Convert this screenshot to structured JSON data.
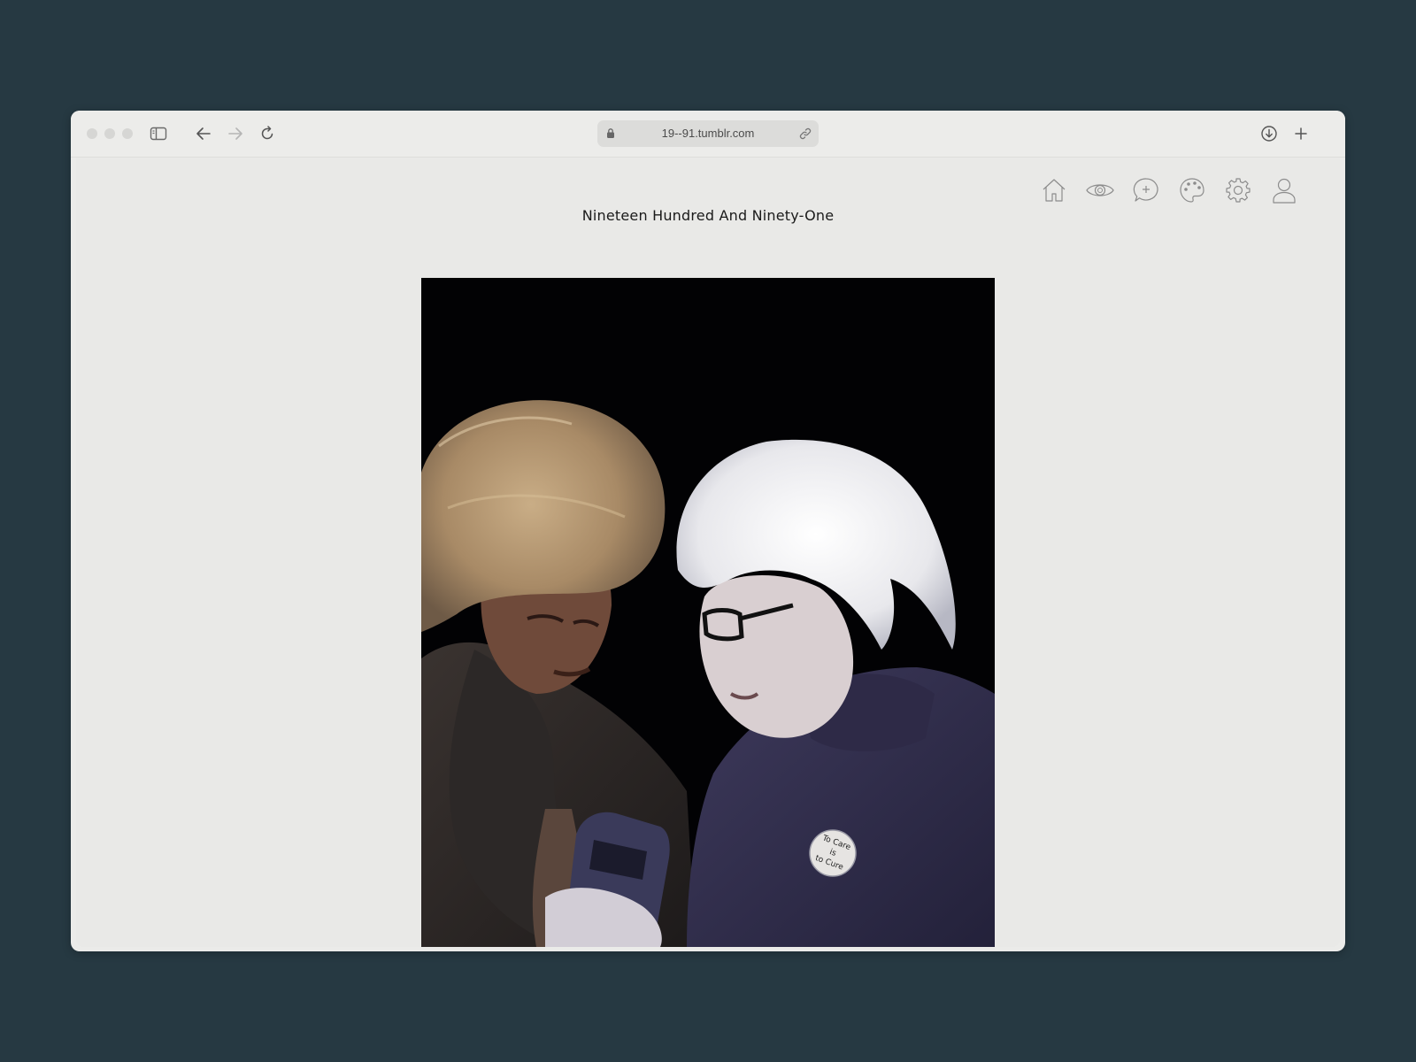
{
  "browser": {
    "url": "19--91.tumblr.com"
  },
  "site": {
    "title": "Nineteen Hundred And Ninety-One",
    "nav_icons": [
      "home-icon",
      "eye-icon",
      "chat-plus-icon",
      "palette-icon",
      "gear-icon",
      "user-icon"
    ]
  },
  "post": {
    "badge_line1": "To Care",
    "badge_line2": "is",
    "badge_line3": "to Cure"
  }
}
